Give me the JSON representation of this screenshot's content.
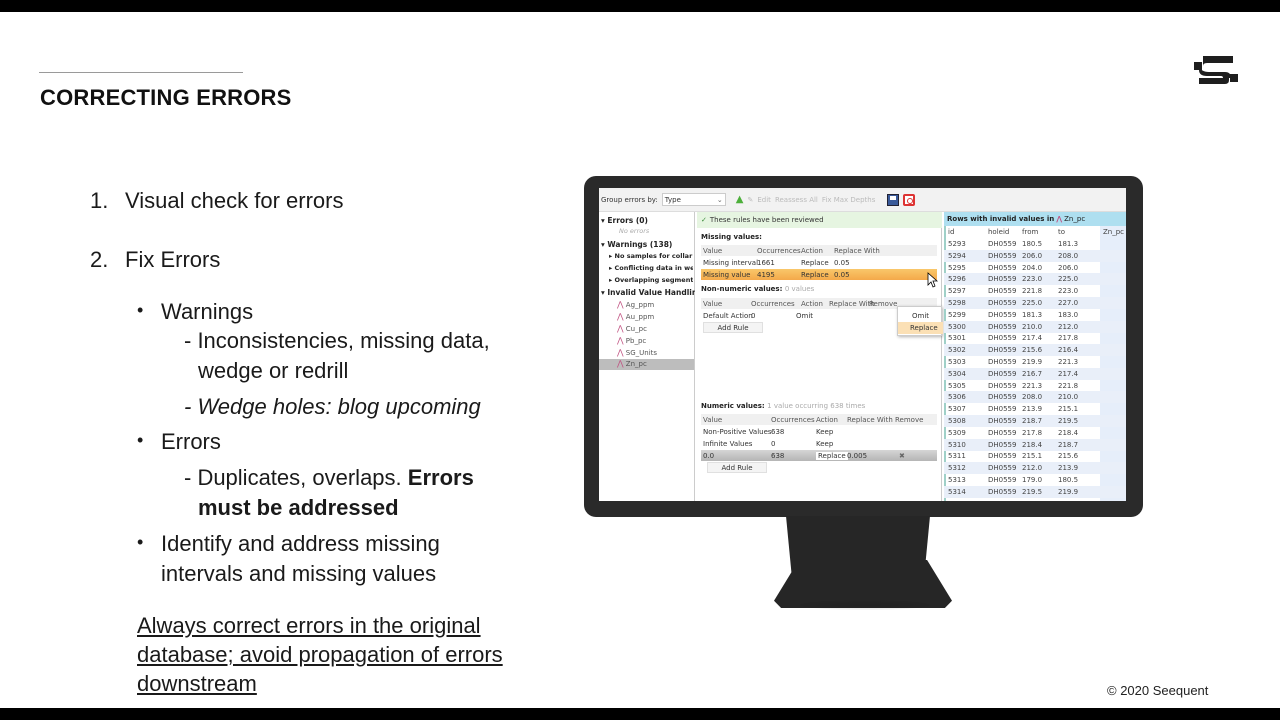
{
  "slide": {
    "title": "CORRECTING ERRORS",
    "copyright": "© 2020 Seequent",
    "logo": "seequent-s-logo-icon",
    "list": {
      "item1": {
        "num": "1.",
        "text": "Visual check for errors"
      },
      "item2": {
        "num": "2.",
        "text": "Fix Errors"
      },
      "warnings": {
        "bullet": "•",
        "label": "Warnings",
        "sub1_line1": "- Inconsistencies, missing data,",
        "sub1_line2": "wedge or redrill",
        "sub2": "- Wedge holes: blog upcoming"
      },
      "errors": {
        "bullet": "•",
        "label": "Errors",
        "sub1_prefix": "- Duplicates, overlaps. ",
        "sub1_bold1": "Errors",
        "sub1_bold2": "must be addressed"
      },
      "identify": {
        "bullet": "•",
        "line1": "Identify and address missing",
        "line2": "intervals and missing values"
      }
    },
    "note": {
      "line1": "Always correct errors in the original",
      "line2": "database; avoid propagation of errors",
      "line3": "downstream"
    }
  },
  "app": {
    "toolbar": {
      "group_label": "Group errors by:",
      "group_value": "Type",
      "buttons": [
        "Edit",
        "Reassess All",
        "Fix Max Depths"
      ],
      "icons": [
        "green-up-arrow-icon",
        "edit-icon",
        "reassess-icon",
        "fix-depths-icon",
        "save-icon",
        "help-icon"
      ]
    },
    "tree": {
      "errors": "Errors (0)",
      "no_errors": "No errors",
      "warnings": "Warnings (138)",
      "warning_items": [
        "No samples for collar",
        "Conflicting data in wedge",
        "Overlapping segment"
      ],
      "invalid": "Invalid Value Handling",
      "columns": [
        "Ag_ppm",
        "Au_ppm",
        "Cu_pc",
        "Pb_pc",
        "SG_Units",
        "Zn_pc"
      ],
      "selected": "Zn_pc"
    },
    "rules": {
      "reviewed": "These rules have been reviewed",
      "missing": {
        "title": "Missing values:",
        "headers": [
          "Value",
          "Occurrences",
          "Action",
          "Replace With"
        ],
        "rows": [
          [
            "Missing interval",
            "1661",
            "Replace",
            "0.05"
          ],
          [
            "Missing value",
            "4195",
            "Replace",
            "0.05"
          ]
        ]
      },
      "popup": [
        "Omit",
        "Replace"
      ],
      "nonnumeric": {
        "title": "Non-numeric values:",
        "subtitle": "0 values",
        "headers": [
          "Value",
          "Occurrences",
          "Action",
          "Replace With",
          "Remove"
        ],
        "rows": [
          [
            "Default Action",
            "0",
            "Omit",
            "",
            ""
          ]
        ],
        "add_rule": "Add Rule"
      },
      "numeric": {
        "title": "Numeric values:",
        "subtitle": "1 value occurring 638 times",
        "headers": [
          "Value",
          "Occurrences",
          "Action",
          "Replace With",
          "Remove"
        ],
        "rows": [
          [
            "Non-Positive Values",
            "638",
            "Keep",
            "",
            ""
          ],
          [
            "Infinite Values",
            "0",
            "Keep",
            "",
            ""
          ],
          [
            "0.0",
            "638",
            "Replace",
            "0.005",
            "✖"
          ]
        ],
        "add_rule": "Add Rule"
      }
    },
    "invalid_rows": {
      "title": "Rows with invalid values in",
      "column": "Zn_pc",
      "headers": [
        "id",
        "holeid",
        "from",
        "to",
        "Zn_pc"
      ],
      "rows": [
        [
          "5293",
          "DH0559",
          "180.5",
          "181.3"
        ],
        [
          "5294",
          "DH0559",
          "206.0",
          "208.0"
        ],
        [
          "5295",
          "DH0559",
          "204.0",
          "206.0"
        ],
        [
          "5296",
          "DH0559",
          "223.0",
          "225.0"
        ],
        [
          "5297",
          "DH0559",
          "221.8",
          "223.0"
        ],
        [
          "5298",
          "DH0559",
          "225.0",
          "227.0"
        ],
        [
          "5299",
          "DH0559",
          "181.3",
          "183.0"
        ],
        [
          "5300",
          "DH0559",
          "210.0",
          "212.0"
        ],
        [
          "5301",
          "DH0559",
          "217.4",
          "217.8"
        ],
        [
          "5302",
          "DH0559",
          "215.6",
          "216.4"
        ],
        [
          "5303",
          "DH0559",
          "219.9",
          "221.3"
        ],
        [
          "5304",
          "DH0559",
          "216.7",
          "217.4"
        ],
        [
          "5305",
          "DH0559",
          "221.3",
          "221.8"
        ],
        [
          "5306",
          "DH0559",
          "208.0",
          "210.0"
        ],
        [
          "5307",
          "DH0559",
          "213.9",
          "215.1"
        ],
        [
          "5308",
          "DH0559",
          "218.7",
          "219.5"
        ],
        [
          "5309",
          "DH0559",
          "217.8",
          "218.4"
        ],
        [
          "5310",
          "DH0559",
          "218.4",
          "218.7"
        ],
        [
          "5311",
          "DH0559",
          "215.1",
          "215.6"
        ],
        [
          "5312",
          "DH0559",
          "212.0",
          "213.9"
        ],
        [
          "5313",
          "DH0559",
          "179.0",
          "180.5"
        ],
        [
          "5314",
          "DH0559",
          "219.5",
          "219.9"
        ]
      ]
    }
  }
}
